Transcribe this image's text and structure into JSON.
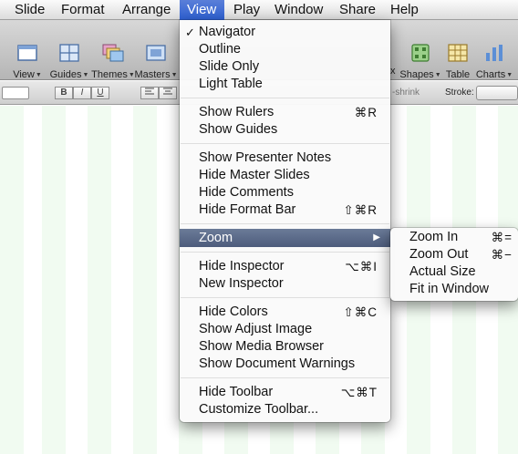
{
  "menubar": {
    "items": [
      {
        "label": "Slide"
      },
      {
        "label": "Format"
      },
      {
        "label": "Arrange"
      },
      {
        "label": "View"
      },
      {
        "label": "Play"
      },
      {
        "label": "Window"
      },
      {
        "label": "Share"
      },
      {
        "label": "Help"
      }
    ]
  },
  "toolbar": {
    "view": "View",
    "guides": "Guides",
    "themes": "Themes",
    "masters": "Masters",
    "partial_x": "x",
    "shapes": "Shapes",
    "table": "Table",
    "charts": "Charts"
  },
  "formatbar": {
    "bold": "B",
    "italic": "I",
    "underline": "U",
    "shrink_label": "-shrink",
    "stroke_label": "Stroke:"
  },
  "view_menu": {
    "items": [
      {
        "label": "Navigator",
        "checked": "✓"
      },
      {
        "label": "Outline"
      },
      {
        "label": "Slide Only"
      },
      {
        "label": "Light Table"
      },
      {
        "label": "Show Rulers",
        "shortcut": "⌘R"
      },
      {
        "label": "Show Guides"
      },
      {
        "label": "Show Presenter Notes"
      },
      {
        "label": "Hide Master Slides"
      },
      {
        "label": "Hide Comments"
      },
      {
        "label": "Hide Format Bar",
        "shortcut": "⇧⌘R"
      },
      {
        "label": "Zoom",
        "submenu_arrow": "▶"
      },
      {
        "label": "Hide Inspector",
        "shortcut": "⌥⌘I"
      },
      {
        "label": "New Inspector"
      },
      {
        "label": "Hide Colors",
        "shortcut": "⇧⌘C"
      },
      {
        "label": "Show Adjust Image"
      },
      {
        "label": "Show Media Browser"
      },
      {
        "label": "Show Document Warnings"
      },
      {
        "label": "Hide Toolbar",
        "shortcut": "⌥⌘T"
      },
      {
        "label": "Customize Toolbar..."
      }
    ]
  },
  "zoom_menu": {
    "items": [
      {
        "label": "Zoom In",
        "shortcut": "⌘="
      },
      {
        "label": "Zoom Out",
        "shortcut": "⌘−"
      },
      {
        "label": "Actual Size"
      },
      {
        "label": "Fit in Window"
      }
    ]
  },
  "colors": {
    "menu_highlight": "#4d5c7c",
    "menubar_open": "#2d5fd1",
    "canvas_stripe": "#f1fbf1"
  }
}
